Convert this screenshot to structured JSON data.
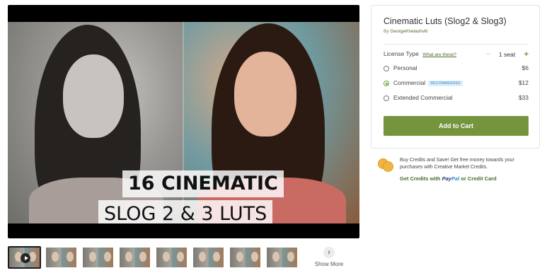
{
  "preview": {
    "caption_line1": "16 CINEMATIC",
    "caption_line2": "SLOG 2 & 3 LUTS"
  },
  "thumbnails": {
    "count": 8,
    "active_index": 0,
    "show_more_icon": "chevron-right-icon",
    "show_more_label": "Show More"
  },
  "product": {
    "title": "Cinematic Luts (Slog2 & Slog3)",
    "by_prefix": "By",
    "author": "GeorgeKhelashvili"
  },
  "license": {
    "label": "License Type",
    "help_link": "What are these?",
    "seats_value": "1 seat",
    "minus_symbol": "−",
    "plus_symbol": "+",
    "options": [
      {
        "name": "Personal",
        "price": "$6",
        "selected": false,
        "badge": ""
      },
      {
        "name": "Commercial",
        "price": "$12",
        "selected": true,
        "badge": "RECOMMENDED"
      },
      {
        "name": "Extended Commercial",
        "price": "$33",
        "selected": false,
        "badge": ""
      }
    ]
  },
  "cart": {
    "add_label": "Add to Cart",
    "accent_color": "#75953d"
  },
  "credits": {
    "text": "Buy Credits and Save! Get free money towards your purchases with Creative Market Credits.",
    "link_prefix": "Get Credits with",
    "paypal_part1": "Pay",
    "paypal_part2": "Pal",
    "link_suffix": "or Credit Card",
    "icon": "coins-icon"
  }
}
